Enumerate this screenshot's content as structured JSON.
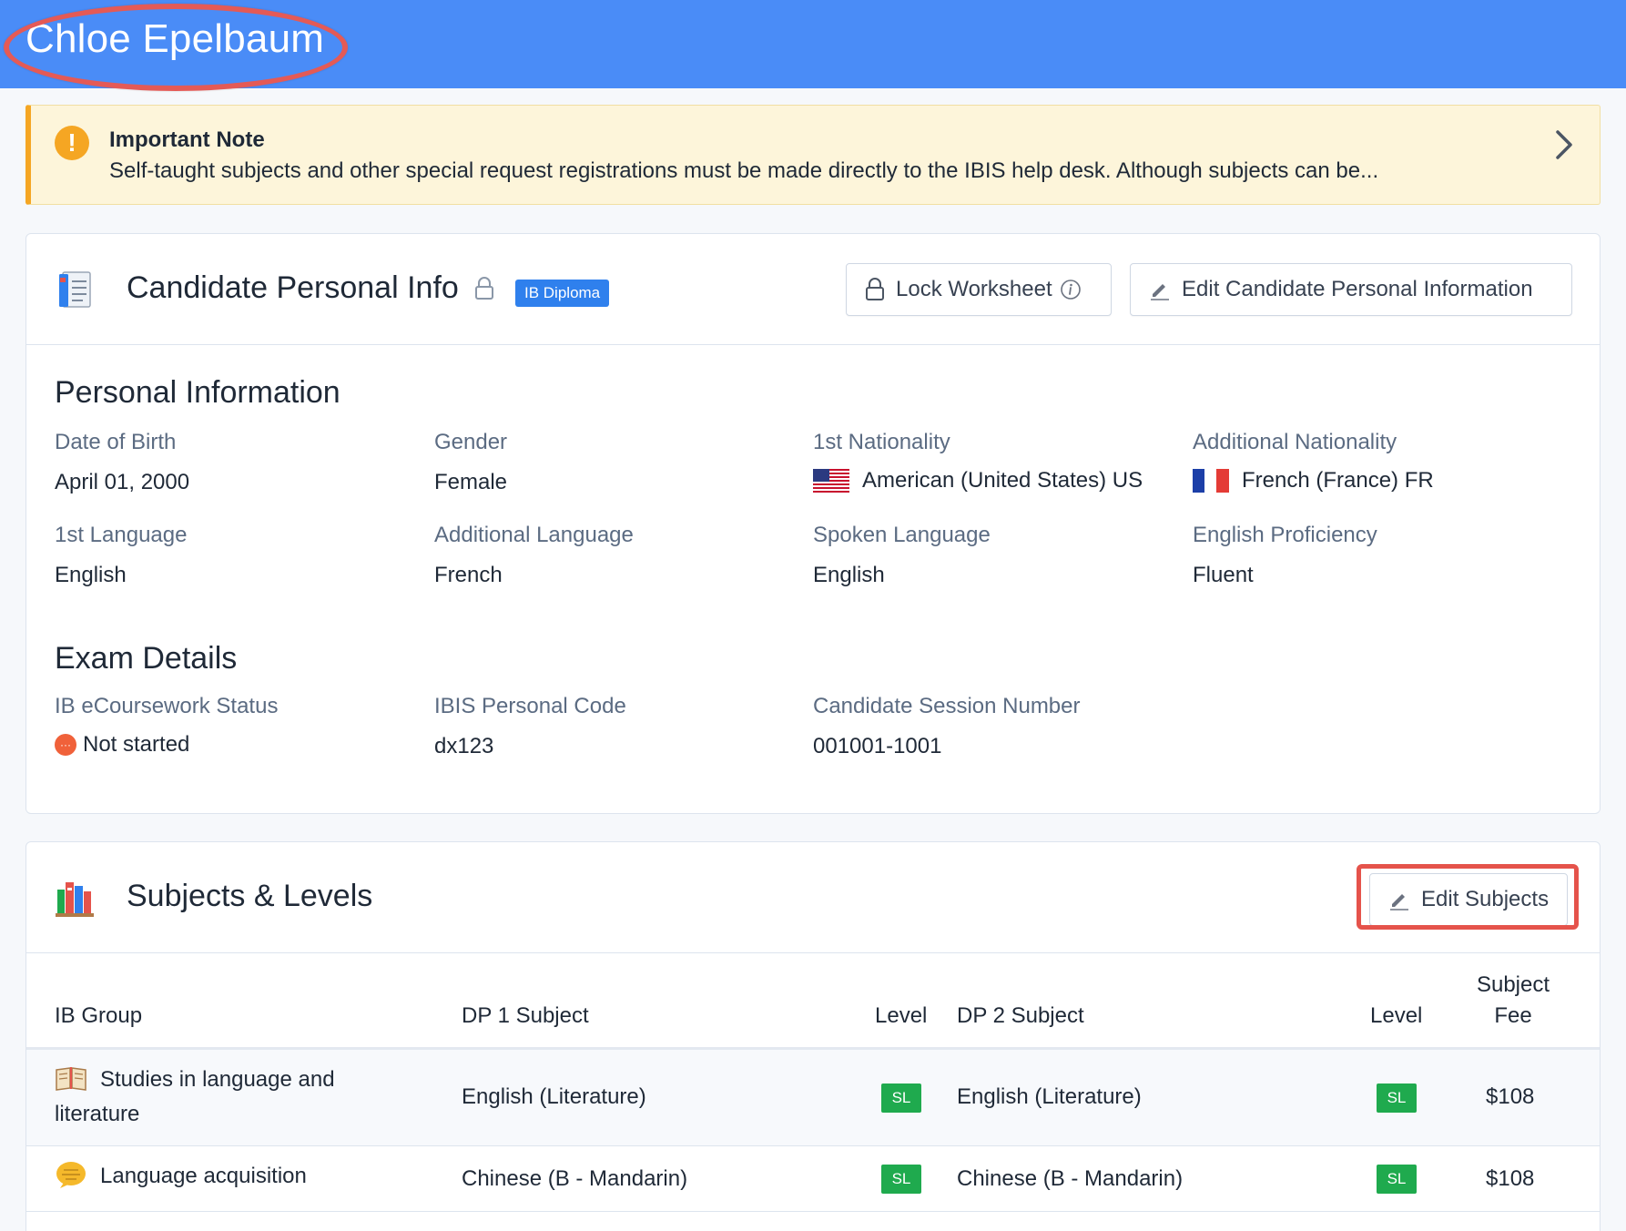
{
  "header": {
    "candidate_name": "Chloe Epelbaum"
  },
  "note": {
    "title": "Important Note",
    "body": "Self-taught subjects and other special request registrations must be made directly to the IBIS help desk. Although subjects can be..."
  },
  "personal_card": {
    "title": "Candidate Personal Info",
    "badge": "IB Diploma",
    "lock_button": "Lock Worksheet",
    "edit_button": "Edit Candidate Personal Information",
    "personal_section": "Personal Information",
    "fields": [
      {
        "label": "Date of Birth",
        "value": "April 01, 2000"
      },
      {
        "label": "Gender",
        "value": "Female"
      },
      {
        "label": "1st Nationality",
        "value": "American (United States) US",
        "flag": "us-flag-icon"
      },
      {
        "label": "Additional Nationality",
        "value": "French (France) FR",
        "flag": "fr-flag-icon"
      },
      {
        "label": "1st Language",
        "value": "English"
      },
      {
        "label": "Additional Language",
        "value": "French"
      },
      {
        "label": "Spoken Language",
        "value": "English"
      },
      {
        "label": "English Proficiency",
        "value": "Fluent"
      }
    ],
    "exam_section": "Exam Details",
    "exam_fields": [
      {
        "label": "IB eCoursework Status",
        "value": "Not started",
        "status_icon": "···"
      },
      {
        "label": "IBIS Personal Code",
        "value": "dx123"
      },
      {
        "label": "Candidate Session Number",
        "value": "001001-1001"
      }
    ]
  },
  "subjects_card": {
    "title": "Subjects & Levels",
    "edit_button": "Edit Subjects",
    "columns": {
      "group": "IB Group",
      "dp1": "DP 1 Subject",
      "level1": "Level",
      "dp2": "DP 2 Subject",
      "level2": "Level",
      "fee_line1": "Subject",
      "fee_line2": "Fee"
    },
    "rows": [
      {
        "group": "Studies in language and literature",
        "dp1": "English (Literature)",
        "level1": "SL",
        "dp2": "English (Literature)",
        "level2": "SL",
        "fee": "$108"
      },
      {
        "group": "Language acquisition",
        "dp1": "Chinese (B - Mandarin)",
        "level1": "SL",
        "dp2": "Chinese (B - Mandarin)",
        "level2": "SL",
        "fee": "$108"
      }
    ]
  },
  "colors": {
    "topbar": "#4a8cf7",
    "note_bg": "#fdf5da",
    "note_accent": "#f5a623",
    "badge": "#2f80ed",
    "sl_badge": "#1faa4e",
    "highlight": "#e5534b"
  }
}
